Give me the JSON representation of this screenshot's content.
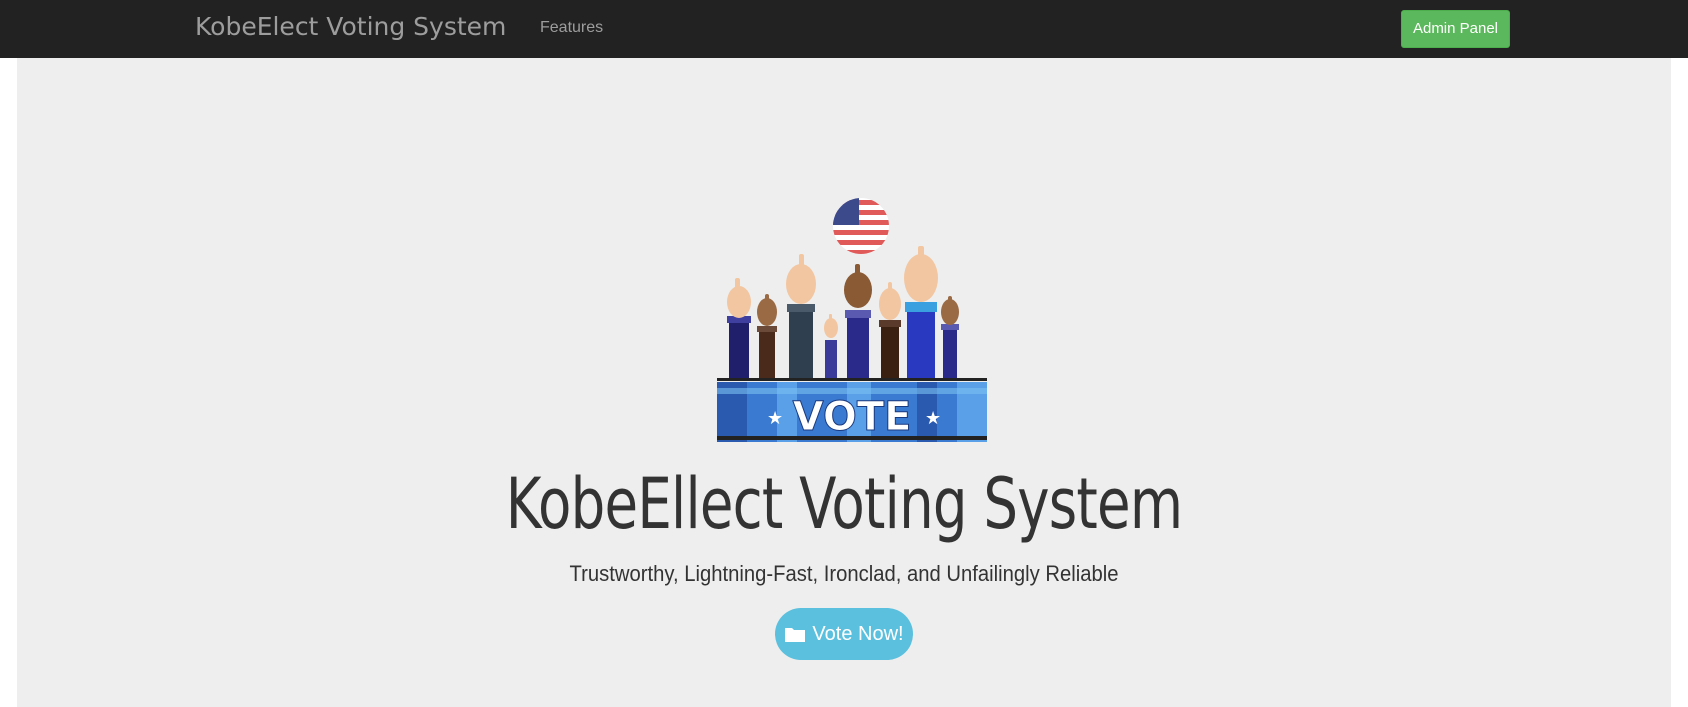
{
  "navbar": {
    "brand": "KobeElect Voting System",
    "links": [
      {
        "label": "Features"
      }
    ],
    "admin_button": "Admin Panel"
  },
  "hero": {
    "image_icon": "vote-hands-illustration",
    "image_text": "VOTE",
    "title": "KobeEllect Voting System",
    "subtitle": "Trustworthy, Lightning-Fast, Ironclad, and Unfailingly Reliable",
    "vote_button": "Vote Now!",
    "vote_button_icon": "folder-icon"
  },
  "colors": {
    "navbar_bg": "#222222",
    "admin_button": "#5cb85c",
    "vote_button": "#5bc0de",
    "jumbotron_bg": "#eeeeee",
    "title_text": "#333333"
  }
}
